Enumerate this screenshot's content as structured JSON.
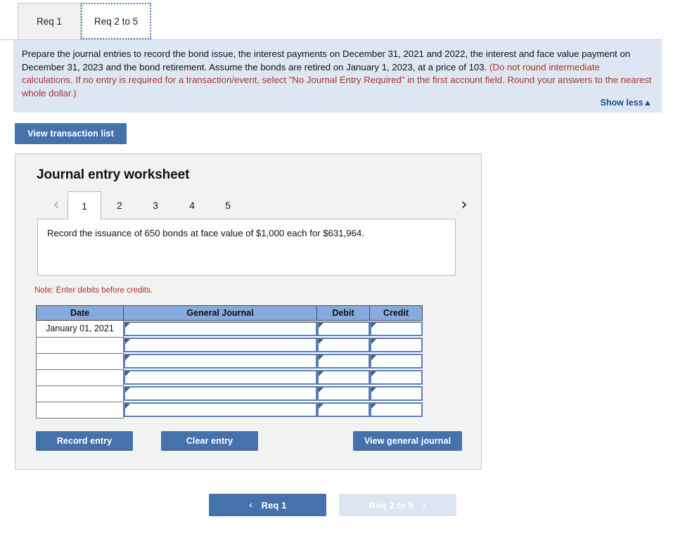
{
  "tabs": [
    {
      "label": "Req 1",
      "active": false
    },
    {
      "label": "Req 2 to 5",
      "active": true
    }
  ],
  "instructions": {
    "part1": "Prepare the journal entries to record the bond issue, the interest payments on December 31, 2021 and 2022, the interest and face value payment on December 31, 2023 and the bond retirement. Assume the bonds are retired on January 1, 2023, at a price of 103. ",
    "part2": "(Do not round intermediate calculations. If no entry is required for a transaction/event, select \"No Journal Entry Required\" in the first account field. Round your answers to the nearest whole dollar.)",
    "show_less_label": "Show less",
    "show_less_caret": "▲"
  },
  "toolbar": {
    "view_transaction_list_label": "View transaction list"
  },
  "worksheet": {
    "title": "Journal entry worksheet",
    "pager": {
      "prev_icon": "‹",
      "next_icon": "›",
      "pages": [
        "1",
        "2",
        "3",
        "4",
        "5"
      ],
      "active_page": "1"
    },
    "question": "Record the issuance of 650 bonds at face value of $1,000 each for $631,964.",
    "note": "Note: Enter debits before credits.",
    "table": {
      "headers": [
        "Date",
        "General Journal",
        "Debit",
        "Credit"
      ],
      "rows": [
        {
          "date": "January 01, 2021",
          "general_journal": "",
          "debit": "",
          "credit": ""
        },
        {
          "date": "",
          "general_journal": "",
          "debit": "",
          "credit": ""
        },
        {
          "date": "",
          "general_journal": "",
          "debit": "",
          "credit": ""
        },
        {
          "date": "",
          "general_journal": "",
          "debit": "",
          "credit": ""
        },
        {
          "date": "",
          "general_journal": "",
          "debit": "",
          "credit": ""
        },
        {
          "date": "",
          "general_journal": "",
          "debit": "",
          "credit": ""
        }
      ]
    },
    "actions": {
      "record_entry_label": "Record entry",
      "clear_entry_label": "Clear entry",
      "view_general_journal_label": "View general journal"
    }
  },
  "footer_nav": {
    "prev_label": "Req 1",
    "prev_icon": "‹",
    "next_label": "Req 2 to 5",
    "next_icon": "›"
  },
  "colors": {
    "accent_blue": "#4672ac",
    "panel_blue": "#dce7f3",
    "table_header_blue": "#87aade",
    "alert_red": "#b23027",
    "link_blue": "#1f4e8c",
    "disabled_blue": "#dbe4f0"
  }
}
